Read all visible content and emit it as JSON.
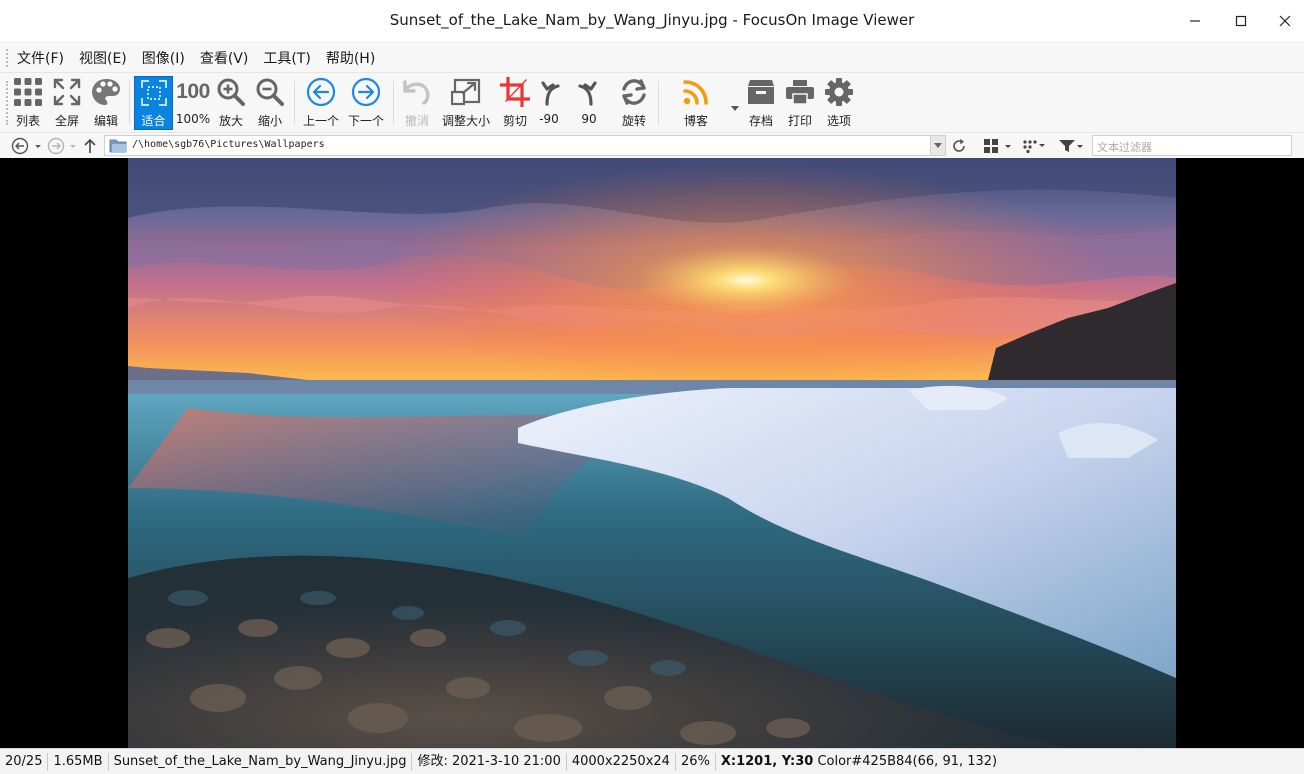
{
  "window": {
    "title": "Sunset_of_the_Lake_Nam_by_Wang_Jinyu.jpg - FocusOn Image Viewer"
  },
  "menu": [
    {
      "label": "文件(F)"
    },
    {
      "label": "视图(E)"
    },
    {
      "label": "图像(I)"
    },
    {
      "label": "查看(V)"
    },
    {
      "label": "工具(T)"
    },
    {
      "label": "帮助(H)"
    }
  ],
  "toolbar": {
    "list": "列表",
    "fullscreen": "全屏",
    "edit": "编辑",
    "fit": "适合",
    "actual_icon": "100",
    "actual": "100%",
    "zoom_in": "放大",
    "zoom_out": "缩小",
    "prev": "上一个",
    "next": "下一个",
    "undo": "撤消",
    "resize": "调整大小",
    "crop": "剪切",
    "rotate_left": "-90",
    "rotate_right": "90",
    "rotate": "旋转",
    "blog": "博客",
    "save": "存档",
    "print": "打印",
    "options": "选项"
  },
  "addressbar": {
    "path": "/\\home\\sgb76\\Pictures\\Wallpapers",
    "filter_placeholder": "文本过滤器"
  },
  "status": {
    "index": "20/25",
    "filesize": "1.65MB",
    "filename": "Sunset_of_the_Lake_Nam_by_Wang_Jinyu.jpg",
    "modified": "修改: 2021-3-10 21:00",
    "dimensions": "4000x2250x24",
    "zoom": "26%",
    "coords": "X:1201, Y:30",
    "color": "Color#425B84(66, 91, 132)"
  },
  "colors": {
    "accent": "#0a84e0",
    "nav_blue": "#1e88e5",
    "crop_red": "#e53935",
    "rss_orange": "#f39c12"
  }
}
